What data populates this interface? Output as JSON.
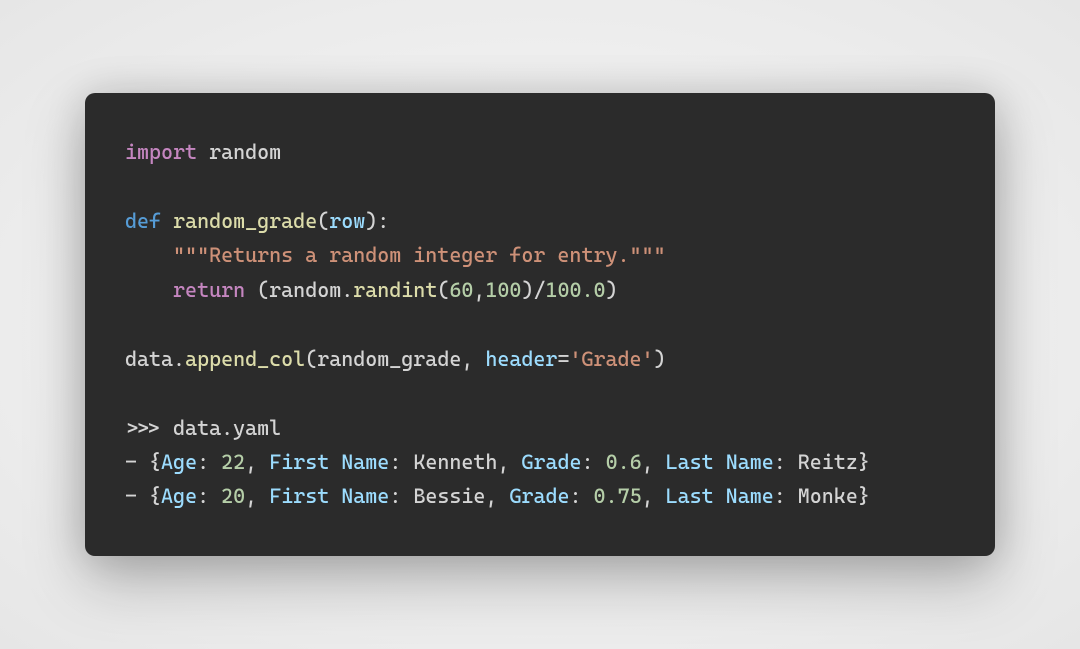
{
  "code": {
    "l1_import": "import",
    "l1_random": " random",
    "l3_def": "def",
    "l3_space": " ",
    "l3_fname": "random_grade",
    "l3_open": "(",
    "l3_param": "row",
    "l3_close": "):",
    "l4_indent": "    ",
    "l4_doc": "\"\"\"Returns a random integer for entry.\"\"\"",
    "l5_indent": "    ",
    "l5_return": "return",
    "l5_sp": " ",
    "l5_open": "(",
    "l5_randmod": "random",
    "l5_dot1": ".",
    "l5_randint": "randint",
    "l5_open2": "(",
    "l5_n60": "60",
    "l5_comma": ",",
    "l5_n100": "100",
    "l5_close2": ")/",
    "l5_n100f": "100.0",
    "l5_close": ")",
    "l7_data": "data",
    "l7_dot": ".",
    "l7_append": "append_col",
    "l7_open": "(",
    "l7_arg1": "random_grade",
    "l7_comma": ", ",
    "l7_kw": "header",
    "l7_eq": "=",
    "l7_str": "'Grade'",
    "l7_close": ")",
    "l9_prompt": ">>> ",
    "l9_data": "data",
    "l9_dot": ".",
    "l9_yaml": "yaml",
    "l10_dash": "- {",
    "l10_k1": "Age",
    "l10_c1": ": ",
    "l10_v1": "22",
    "l10_s1": ", ",
    "l10_k2": "First Name",
    "l10_c2": ": ",
    "l10_v2": "Kenneth",
    "l10_s2": ", ",
    "l10_k3": "Grade",
    "l10_c3": ": ",
    "l10_v3": "0.6",
    "l10_s3": ", ",
    "l10_k4": "Last Name",
    "l10_c4": ": ",
    "l10_v4": "Reitz",
    "l10_end": "}",
    "l11_dash": "- {",
    "l11_k1": "Age",
    "l11_c1": ": ",
    "l11_v1": "20",
    "l11_s1": ", ",
    "l11_k2": "First Name",
    "l11_c2": ": ",
    "l11_v2": "Bessie",
    "l11_s2": ", ",
    "l11_k3": "Grade",
    "l11_c3": ": ",
    "l11_v3": "0.75",
    "l11_s3": ", ",
    "l11_k4": "Last Name",
    "l11_c4": ": ",
    "l11_v4": "Monke",
    "l11_end": "}"
  }
}
